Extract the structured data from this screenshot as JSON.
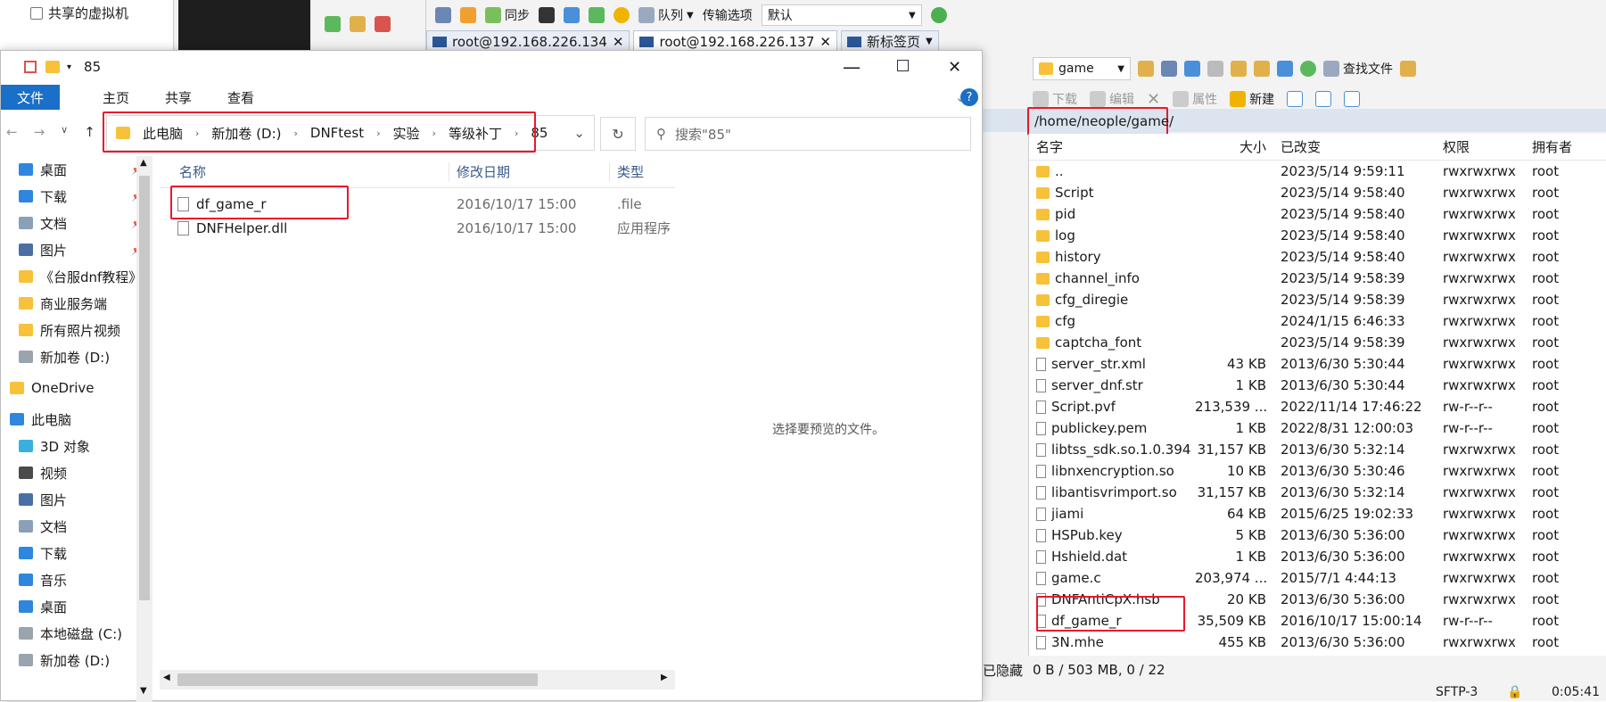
{
  "top": {
    "vm_item": "共享的虚拟机",
    "toolbar": {
      "sync": "同步",
      "queue": "队列",
      "transfer_options": "传输选项",
      "transfer_value": "默认"
    },
    "tabs": [
      {
        "label": "root@192.168.226.134"
      },
      {
        "label": "root@192.168.226.137"
      },
      {
        "label": "新标签页"
      }
    ]
  },
  "explorer": {
    "title": "85",
    "ribbon": [
      "文件",
      "主页",
      "共享",
      "查看"
    ],
    "breadcrumb": [
      "此电脑",
      "新加卷 (D:)",
      "DNFtest",
      "实验",
      "等级补丁",
      "85"
    ],
    "search_placeholder": "搜索\"85\"",
    "nav": [
      {
        "label": "桌面",
        "pinned": true,
        "icon": "desktop-icon"
      },
      {
        "label": "下载",
        "pinned": true,
        "icon": "download-icon"
      },
      {
        "label": "文档",
        "pinned": true,
        "icon": "document-icon"
      },
      {
        "label": "图片",
        "pinned": true,
        "icon": "picture-icon"
      },
      {
        "label": "《台服dnf教程》",
        "pinned": false,
        "icon": "folder-icon"
      },
      {
        "label": "商业服务端",
        "pinned": false,
        "icon": "folder-icon"
      },
      {
        "label": "所有照片视频",
        "pinned": false,
        "icon": "folder-icon"
      },
      {
        "label": "新加卷 (D:)",
        "pinned": false,
        "icon": "drive-icon"
      },
      {
        "label": "OneDrive",
        "pinned": false,
        "icon": "folder-icon"
      },
      {
        "label": "此电脑",
        "pinned": false,
        "icon": "pc-icon"
      },
      {
        "label": "3D 对象",
        "pinned": false,
        "icon": "cube-icon"
      },
      {
        "label": "视频",
        "pinned": false,
        "icon": "video-icon"
      },
      {
        "label": "图片",
        "pinned": false,
        "icon": "picture-icon"
      },
      {
        "label": "文档",
        "pinned": false,
        "icon": "document-icon"
      },
      {
        "label": "下载",
        "pinned": false,
        "icon": "download-icon"
      },
      {
        "label": "音乐",
        "pinned": false,
        "icon": "music-icon"
      },
      {
        "label": "桌面",
        "pinned": false,
        "icon": "desktop-icon"
      },
      {
        "label": "本地磁盘 (C:)",
        "pinned": false,
        "icon": "drive-icon"
      },
      {
        "label": "新加卷 (D:)",
        "pinned": false,
        "icon": "drive-icon"
      }
    ],
    "columns": [
      "名称",
      "修改日期",
      "类型"
    ],
    "files": [
      {
        "name": "df_game_r",
        "date": "2016/10/17 15:00",
        "type": ".file"
      },
      {
        "name": "DNFHelper.dll",
        "date": "2016/10/17 15:00",
        "type": "应用程序"
      }
    ],
    "preview_text": "选择要预览的文件。"
  },
  "ftp": {
    "folder_combo": "game",
    "find_files": "查找文件",
    "download": "下载",
    "edit": "编辑",
    "properties": "属性",
    "new": "新建",
    "path": "/home/neople/game/",
    "columns": [
      "名字",
      "大小",
      "已改变",
      "权限",
      "拥有者"
    ],
    "files": [
      {
        "name": "..",
        "size": "",
        "changed": "2023/5/14 9:59:11",
        "perm": "rwxrwxrwx",
        "owner": "root",
        "icon": "parent-icon"
      },
      {
        "name": "Script",
        "size": "",
        "changed": "2023/5/14 9:58:40",
        "perm": "rwxrwxrwx",
        "owner": "root",
        "icon": "folder-icon"
      },
      {
        "name": "pid",
        "size": "",
        "changed": "2023/5/14 9:58:40",
        "perm": "rwxrwxrwx",
        "owner": "root",
        "icon": "folder-icon"
      },
      {
        "name": "log",
        "size": "",
        "changed": "2023/5/14 9:58:40",
        "perm": "rwxrwxrwx",
        "owner": "root",
        "icon": "folder-icon"
      },
      {
        "name": "history",
        "size": "",
        "changed": "2023/5/14 9:58:40",
        "perm": "rwxrwxrwx",
        "owner": "root",
        "icon": "folder-icon"
      },
      {
        "name": "channel_info",
        "size": "",
        "changed": "2023/5/14 9:58:39",
        "perm": "rwxrwxrwx",
        "owner": "root",
        "icon": "folder-icon"
      },
      {
        "name": "cfg_diregie",
        "size": "",
        "changed": "2023/5/14 9:58:39",
        "perm": "rwxrwxrwx",
        "owner": "root",
        "icon": "folder-icon"
      },
      {
        "name": "cfg",
        "size": "",
        "changed": "2024/1/15 6:46:33",
        "perm": "rwxrwxrwx",
        "owner": "root",
        "icon": "folder-icon"
      },
      {
        "name": "captcha_font",
        "size": "",
        "changed": "2023/5/14 9:58:39",
        "perm": "rwxrwxrwx",
        "owner": "root",
        "icon": "folder-icon"
      },
      {
        "name": "server_str.xml",
        "size": "43 KB",
        "changed": "2013/6/30 5:30:44",
        "perm": "rwxrwxrwx",
        "owner": "root",
        "icon": "file-icon"
      },
      {
        "name": "server_dnf.str",
        "size": "1 KB",
        "changed": "2013/6/30 5:30:44",
        "perm": "rwxrwxrwx",
        "owner": "root",
        "icon": "file-icon"
      },
      {
        "name": "Script.pvf",
        "size": "213,539 ...",
        "changed": "2022/11/14 17:46:22",
        "perm": "rw-r--r--",
        "owner": "root",
        "icon": "file-icon"
      },
      {
        "name": "publickey.pem",
        "size": "1 KB",
        "changed": "2022/8/31 12:00:03",
        "perm": "rw-r--r--",
        "owner": "root",
        "icon": "file-icon"
      },
      {
        "name": "libtss_sdk.so.1.0.394",
        "size": "31,157 KB",
        "changed": "2013/6/30 5:32:14",
        "perm": "rwxrwxrwx",
        "owner": "root",
        "icon": "file-icon"
      },
      {
        "name": "libnxencryption.so",
        "size": "10 KB",
        "changed": "2013/6/30 5:30:46",
        "perm": "rwxrwxrwx",
        "owner": "root",
        "icon": "file-icon"
      },
      {
        "name": "libantisvrimport.so",
        "size": "31,157 KB",
        "changed": "2013/6/30 5:32:14",
        "perm": "rwxrwxrwx",
        "owner": "root",
        "icon": "file-icon"
      },
      {
        "name": "jiami",
        "size": "64 KB",
        "changed": "2015/6/25 19:02:33",
        "perm": "rwxrwxrwx",
        "owner": "root",
        "icon": "file-icon"
      },
      {
        "name": "HSPub.key",
        "size": "5 KB",
        "changed": "2013/6/30 5:36:00",
        "perm": "rwxrwxrwx",
        "owner": "root",
        "icon": "file-icon"
      },
      {
        "name": "Hshield.dat",
        "size": "1 KB",
        "changed": "2013/6/30 5:36:00",
        "perm": "rwxrwxrwx",
        "owner": "root",
        "icon": "file-icon"
      },
      {
        "name": "game.c",
        "size": "203,974 ...",
        "changed": "2015/7/1 4:44:13",
        "perm": "rwxrwxrwx",
        "owner": "root",
        "icon": "file-icon"
      },
      {
        "name": "DNFAntiCpX.hsb",
        "size": "20 KB",
        "changed": "2013/6/30 5:36:00",
        "perm": "rwxrwxrwx",
        "owner": "root",
        "icon": "file-icon"
      },
      {
        "name": "df_game_r",
        "size": "35,509 KB",
        "changed": "2016/10/17 15:00:14",
        "perm": "rw-r--r--",
        "owner": "root",
        "icon": "file-icon"
      },
      {
        "name": "3N.mhe",
        "size": "455 KB",
        "changed": "2013/6/30 5:36:00",
        "perm": "rwxrwxrwx",
        "owner": "root",
        "icon": "file-icon"
      }
    ],
    "status_hidden": "已隐藏",
    "status_info": "0 B / 503 MB,  0 / 22",
    "protocol": "SFTP-3",
    "time": "0:05:41"
  },
  "colors": {
    "highlight": "#e8192c",
    "ribbon_file": "#1a6fc8",
    "folder": "#f7c23a"
  }
}
